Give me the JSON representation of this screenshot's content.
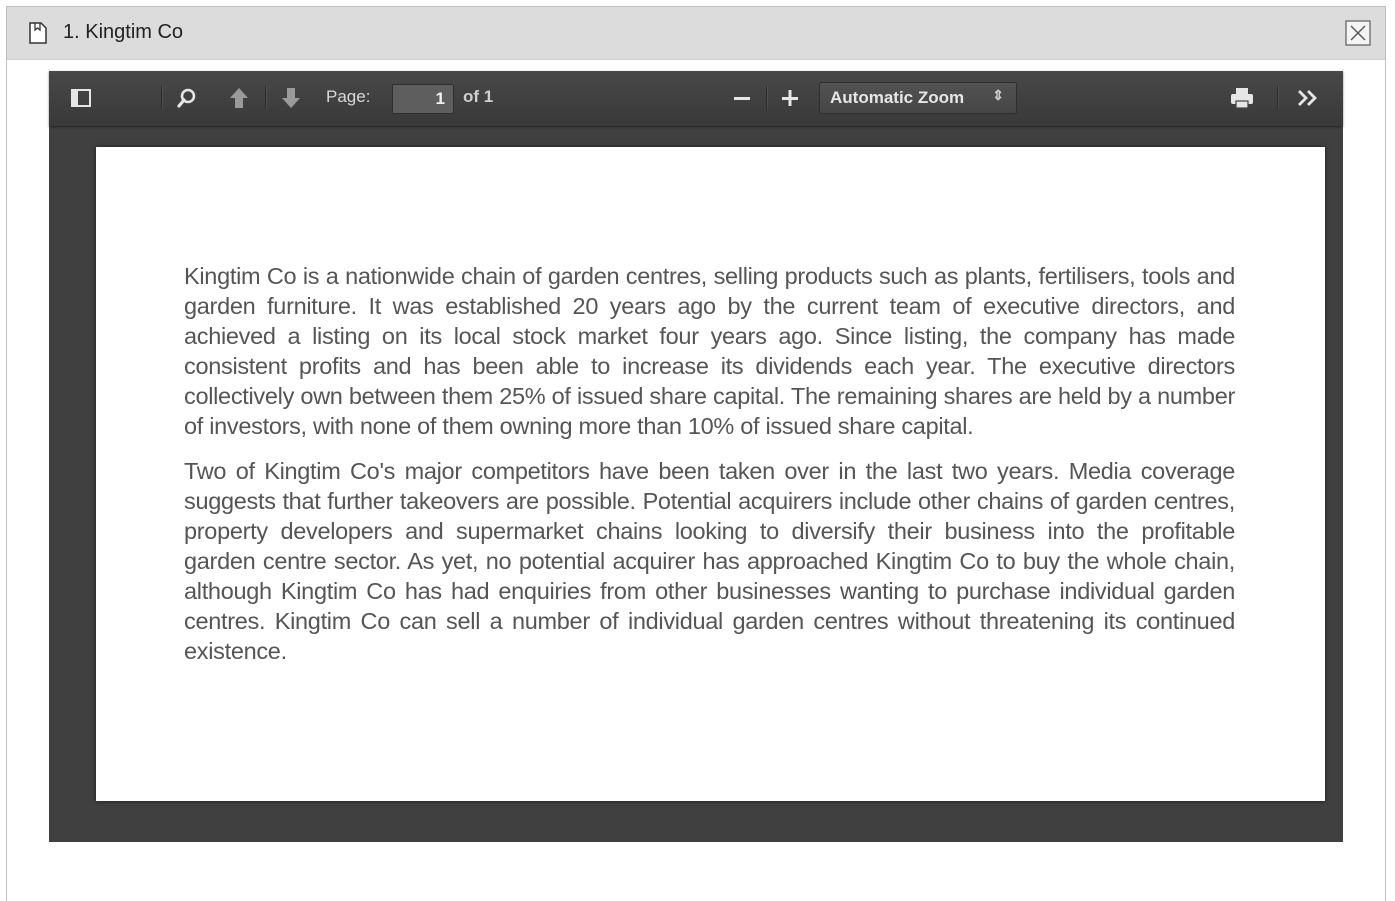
{
  "window": {
    "title": "1. Kingtim Co",
    "icons": {
      "document": "document-icon",
      "close": "close-icon"
    }
  },
  "toolbar": {
    "sidebar_toggle_icon": "sidebar-toggle-icon",
    "search_icon": "search-icon",
    "prev_icon": "arrow-up-icon",
    "next_icon": "arrow-down-icon",
    "page_label": "Page:",
    "page_number": "1",
    "page_count": "of 1",
    "zoom_out_icon": "minus-icon",
    "zoom_in_icon": "plus-icon",
    "zoom_value": "Automatic Zoom",
    "print_icon": "print-icon",
    "more_icon": "double-chevron-right-icon"
  },
  "document": {
    "paragraphs": [
      "Kingtim Co is a nationwide chain of garden centres, selling products such as plants, fertilisers, tools and garden furniture. It was established 20 years ago by the current team of executive directors, and achieved a listing on its local stock market four years ago. Since listing, the company has made consistent profits and has been able to increase its dividends each year. The executive directors collectively own between them 25% of issued share capital. The remaining shares are held by a number of investors, with none of them owning more than 10% of issued share capital.",
      "Two of Kingtim Co's major competitors have been taken over in the last two years. Media coverage suggests that further takeovers are possible. Potential acquirers include other chains of garden centres, property developers and supermarket chains looking to diversify their business into the profitable garden centre sector. As yet, no potential acquirer has approached Kingtim Co to buy the whole chain, although Kingtim Co has had enquiries from other businesses wanting to purchase individual garden centres. Kingtim Co can sell a number of individual garden centres without threatening its continued existence."
    ]
  },
  "colors": {
    "titlebar_bg": "#dcdcdc",
    "viewer_bg": "#404040",
    "toolbar_bg": "#3f3f3f",
    "page_text": "#555555"
  }
}
